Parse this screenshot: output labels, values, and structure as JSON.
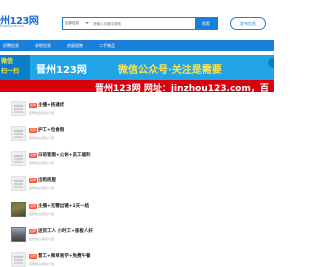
{
  "header": {
    "logo_main": "州123网",
    "logo_sub": "jinzhou123.com",
    "search": {
      "category": "全部信息",
      "placeholder": "请输入关键字搜索",
      "button": "搜索"
    },
    "post_button": "发布信息"
  },
  "nav": {
    "items": [
      "招聘信息",
      "求职信息",
      "房屋租售",
      "二手物品"
    ]
  },
  "banners": {
    "wechat_left": "微信\n扫一扫",
    "wechat_title": "晋州123网",
    "wechat_slogan": "微信公众号·关注是需要",
    "site_line": "晋州123网 网址：jinzhou123.com，百"
  },
  "listings": [
    {
      "tag": "招聘",
      "title": "主播+扬通优",
      "meta": "招聘信息/职位介绍",
      "thumb": "placeholder"
    },
    {
      "tag": "招聘",
      "title": "护工+包食宿",
      "meta": "招聘信息/职位介绍",
      "thumb": "placeholder"
    },
    {
      "tag": "招聘",
      "title": "白班客服+公休+员工福利",
      "meta": "招聘信息/职位介绍",
      "thumb": "placeholder"
    },
    {
      "tag": "招聘",
      "title": "出租房屋",
      "meta": "招聘信息/职位介绍",
      "thumb": "placeholder"
    },
    {
      "tag": "招聘",
      "title": "主播+无需出镜+1天一结",
      "meta": "招聘信息/职位介绍",
      "thumb": "photo"
    },
    {
      "tag": "招聘",
      "title": "送货工人 小时工+底板人好",
      "meta": "招聘信息/职位介绍",
      "thumb": "photo2"
    },
    {
      "tag": "招聘",
      "title": "普工+简单易学+免费午餐",
      "meta": "招聘信息/职位介绍",
      "thumb": "placeholder"
    }
  ]
}
